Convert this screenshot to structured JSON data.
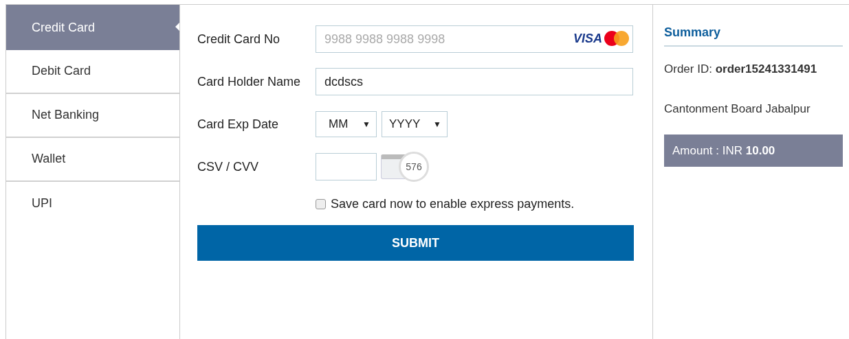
{
  "sidebar": {
    "items": [
      {
        "label": "Credit Card",
        "selected": true
      },
      {
        "label": "Debit Card",
        "selected": false
      },
      {
        "label": "Net Banking",
        "selected": false
      },
      {
        "label": "Wallet",
        "selected": false
      },
      {
        "label": "UPI",
        "selected": false
      }
    ]
  },
  "form": {
    "card_number": {
      "label": "Credit Card No",
      "placeholder": "9988 9988 9988 9998",
      "logo_text": "VISA"
    },
    "holder_name": {
      "label": "Card Holder Name",
      "value": "dcdscs"
    },
    "exp_date": {
      "label": "Card Exp Date",
      "month": "MM",
      "year": "YYYY",
      "caret": "▼"
    },
    "cvv": {
      "label": "CSV / CVV",
      "hint_number": "576"
    },
    "save_card": {
      "label": "Save card now to enable express payments.",
      "checked": false
    },
    "submit": "SUBMIT"
  },
  "summary": {
    "title": "Summary",
    "order_id": "Order ID: **order15241331491**",
    "merchant": "Cantonment Board Jabalpur",
    "amount": "Amount : INR **10.00**"
  }
}
